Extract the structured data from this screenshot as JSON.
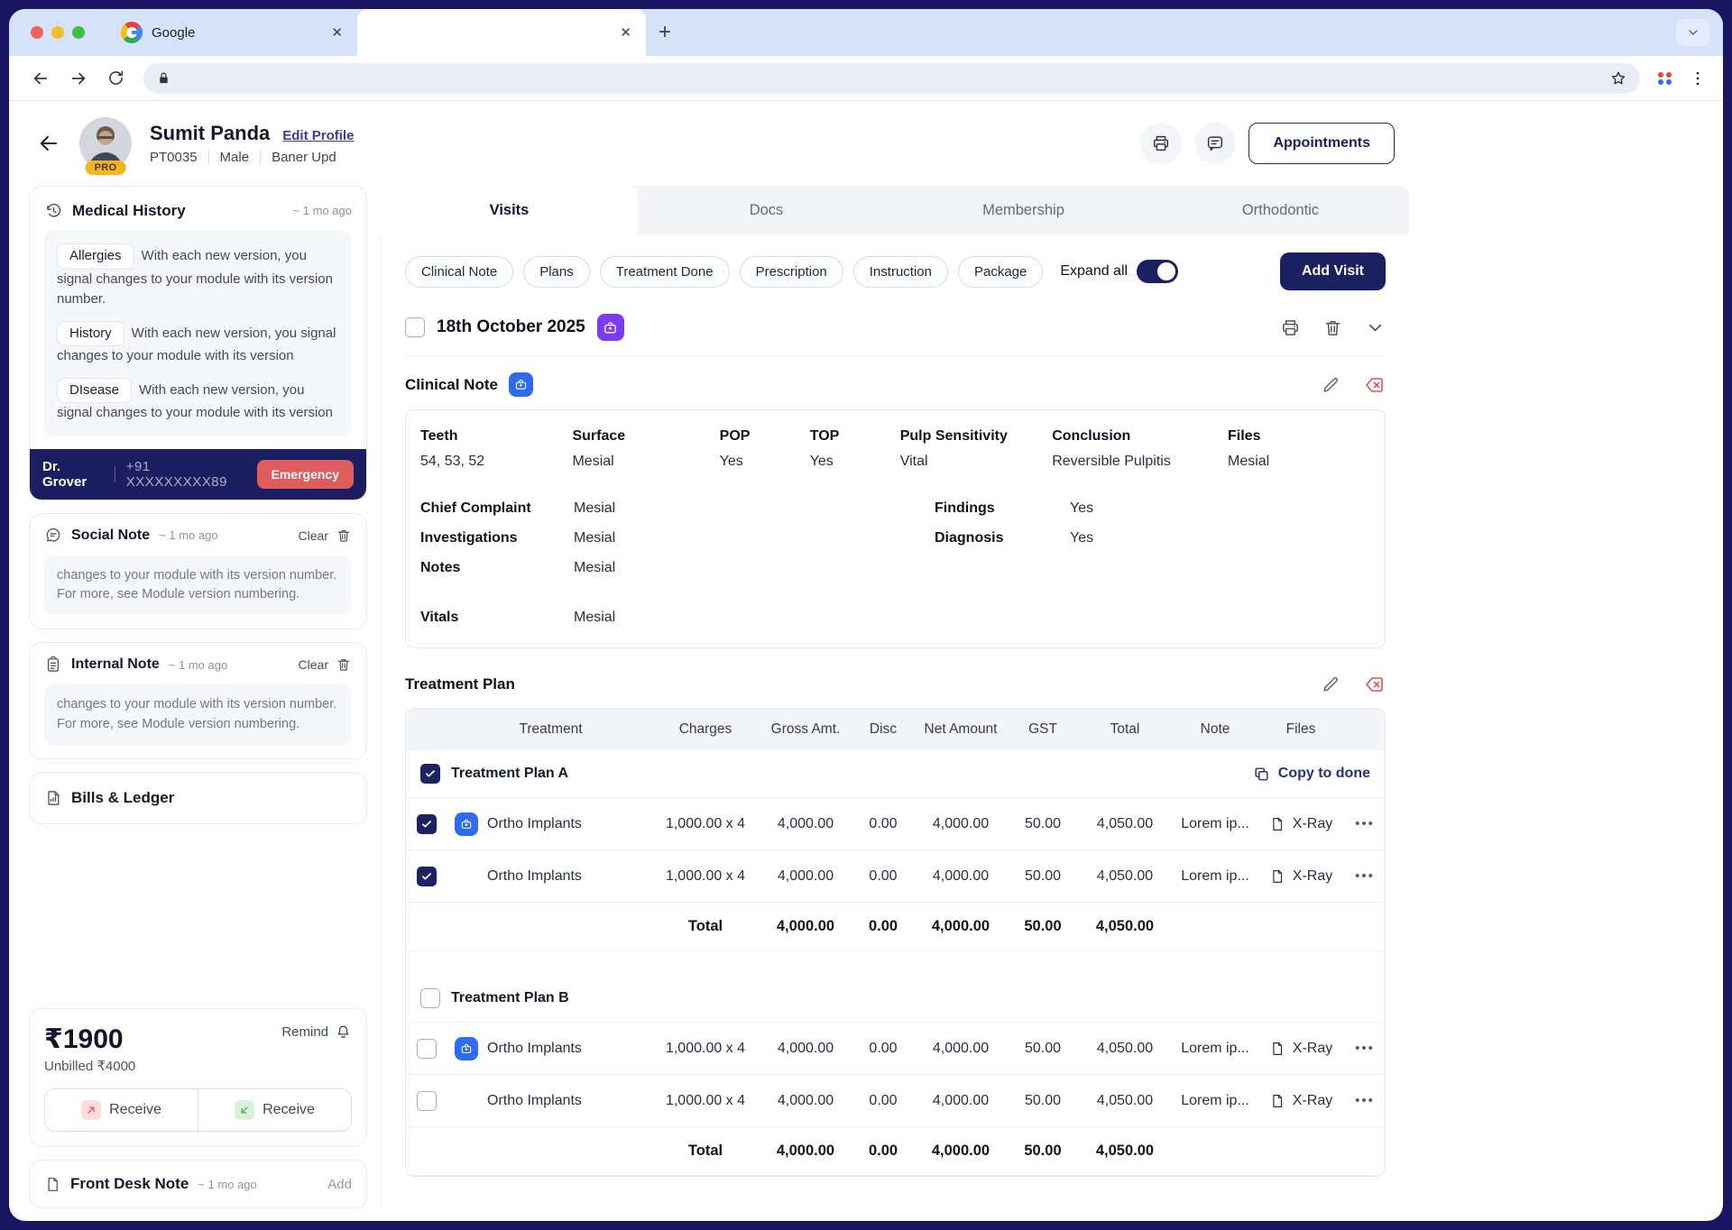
{
  "browser": {
    "tab_title": "Google",
    "close_glyph": "✕",
    "new_tab_glyph": "+"
  },
  "header": {
    "name": "Sumit Panda",
    "edit_profile": "Edit Profile",
    "patient_id": "PT0035",
    "gender": "Male",
    "location": "Baner Upd",
    "badge": "PRO",
    "appointments": "Appointments"
  },
  "sidebar": {
    "medical_history": {
      "title": "Medical History",
      "time": "~ 1 mo ago",
      "entries": [
        {
          "tag": "Allergies",
          "text": "With each new version, you signal changes to your module with its version number."
        },
        {
          "tag": "History",
          "text": "With each new version, you signal changes to your module with its version"
        },
        {
          "tag": "DIsease",
          "text": "With each new version, you signal changes to your module with its version"
        }
      ],
      "doctor": "Dr. Grover",
      "phone": "+91 XXXXXXXXX89",
      "emergency": "Emergency"
    },
    "social_note": {
      "title": "Social Note",
      "time": "~ 1 mo ago",
      "clear": "Clear",
      "text": "changes to your module with its version number. For more, see Module version numbering."
    },
    "internal_note": {
      "title": "Internal Note",
      "time": "~ 1 mo ago",
      "clear": "Clear",
      "text": "changes to your module with its version number. For more, see Module version numbering."
    },
    "bills_ledger": {
      "title": "Bills & Ledger"
    },
    "balance": {
      "amount": "₹1900",
      "remind": "Remind",
      "unbilled": "Unbilled ₹4000",
      "receive_out": "Receive",
      "receive_in": "Receive"
    },
    "front_desk": {
      "title": "Front Desk Note",
      "time": "~ 1 mo ago",
      "add": "Add"
    }
  },
  "main": {
    "tabs": [
      "Visits",
      "Docs",
      "Membership",
      "Orthodontic"
    ],
    "filters": [
      "Clinical Note",
      "Plans",
      "Treatment Done",
      "Prescription",
      "Instruction",
      "Package"
    ],
    "expand_all": "Expand all",
    "add_visit": "Add Visit",
    "visit_date": "18th October 2025",
    "clinical_note": {
      "title": "Clinical Note",
      "headers": [
        "Teeth",
        "Surface",
        "POP",
        "TOP",
        "Pulp Sensitivity",
        "Conclusion",
        "Files"
      ],
      "values": [
        "54, 53, 52",
        "Mesial",
        "Yes",
        "Yes",
        "Vital",
        "Reversible Pulpitis",
        "Mesial"
      ],
      "left_fields": [
        {
          "label": "Chief Complaint",
          "value": "Mesial"
        },
        {
          "label": "Investigations",
          "value": "Mesial"
        },
        {
          "label": "Notes",
          "value": "Mesial"
        },
        {
          "label": "Vitals",
          "value": "Mesial"
        }
      ],
      "right_fields": [
        {
          "label": "Findings",
          "value": "Yes"
        },
        {
          "label": "Diagnosis",
          "value": "Yes"
        }
      ]
    },
    "treatment_plan": {
      "title": "Treatment Plan",
      "columns": [
        "Treatment",
        "Charges",
        "Gross Amt.",
        "Disc",
        "Net Amount",
        "GST",
        "Total",
        "Note",
        "Files"
      ],
      "copy_to_done": "Copy to done",
      "total_label": "Total",
      "more_glyph": "•••",
      "group_a": {
        "name": "Treatment Plan A",
        "rows": [
          {
            "treatment": "Ortho Implants",
            "charges": "1,000.00 x 4",
            "gross": "4,000.00",
            "disc": "0.00",
            "net": "4,000.00",
            "gst": "50.00",
            "total": "4,050.00",
            "note": "Lorem ip...",
            "files": "X-Ray"
          },
          {
            "treatment": "Ortho Implants",
            "charges": "1,000.00 x 4",
            "gross": "4,000.00",
            "disc": "0.00",
            "net": "4,000.00",
            "gst": "50.00",
            "total": "4,050.00",
            "note": "Lorem ip...",
            "files": "X-Ray"
          }
        ],
        "total": {
          "gross": "4,000.00",
          "disc": "0.00",
          "net": "4,000.00",
          "gst": "50.00",
          "total": "4,050.00"
        }
      },
      "group_b": {
        "name": "Treatment Plan B",
        "rows": [
          {
            "treatment": "Ortho Implants",
            "charges": "1,000.00 x 4",
            "gross": "4,000.00",
            "disc": "0.00",
            "net": "4,000.00",
            "gst": "50.00",
            "total": "4,050.00",
            "note": "Lorem ip...",
            "files": "X-Ray"
          },
          {
            "treatment": "Ortho Implants",
            "charges": "1,000.00 x 4",
            "gross": "4,000.00",
            "disc": "0.00",
            "net": "4,000.00",
            "gst": "50.00",
            "total": "4,050.00",
            "note": "Lorem ip...",
            "files": "X-Ray"
          }
        ],
        "total": {
          "gross": "4,000.00",
          "disc": "0.00",
          "net": "4,000.00",
          "gst": "50.00",
          "total": "4,050.00"
        }
      }
    }
  }
}
